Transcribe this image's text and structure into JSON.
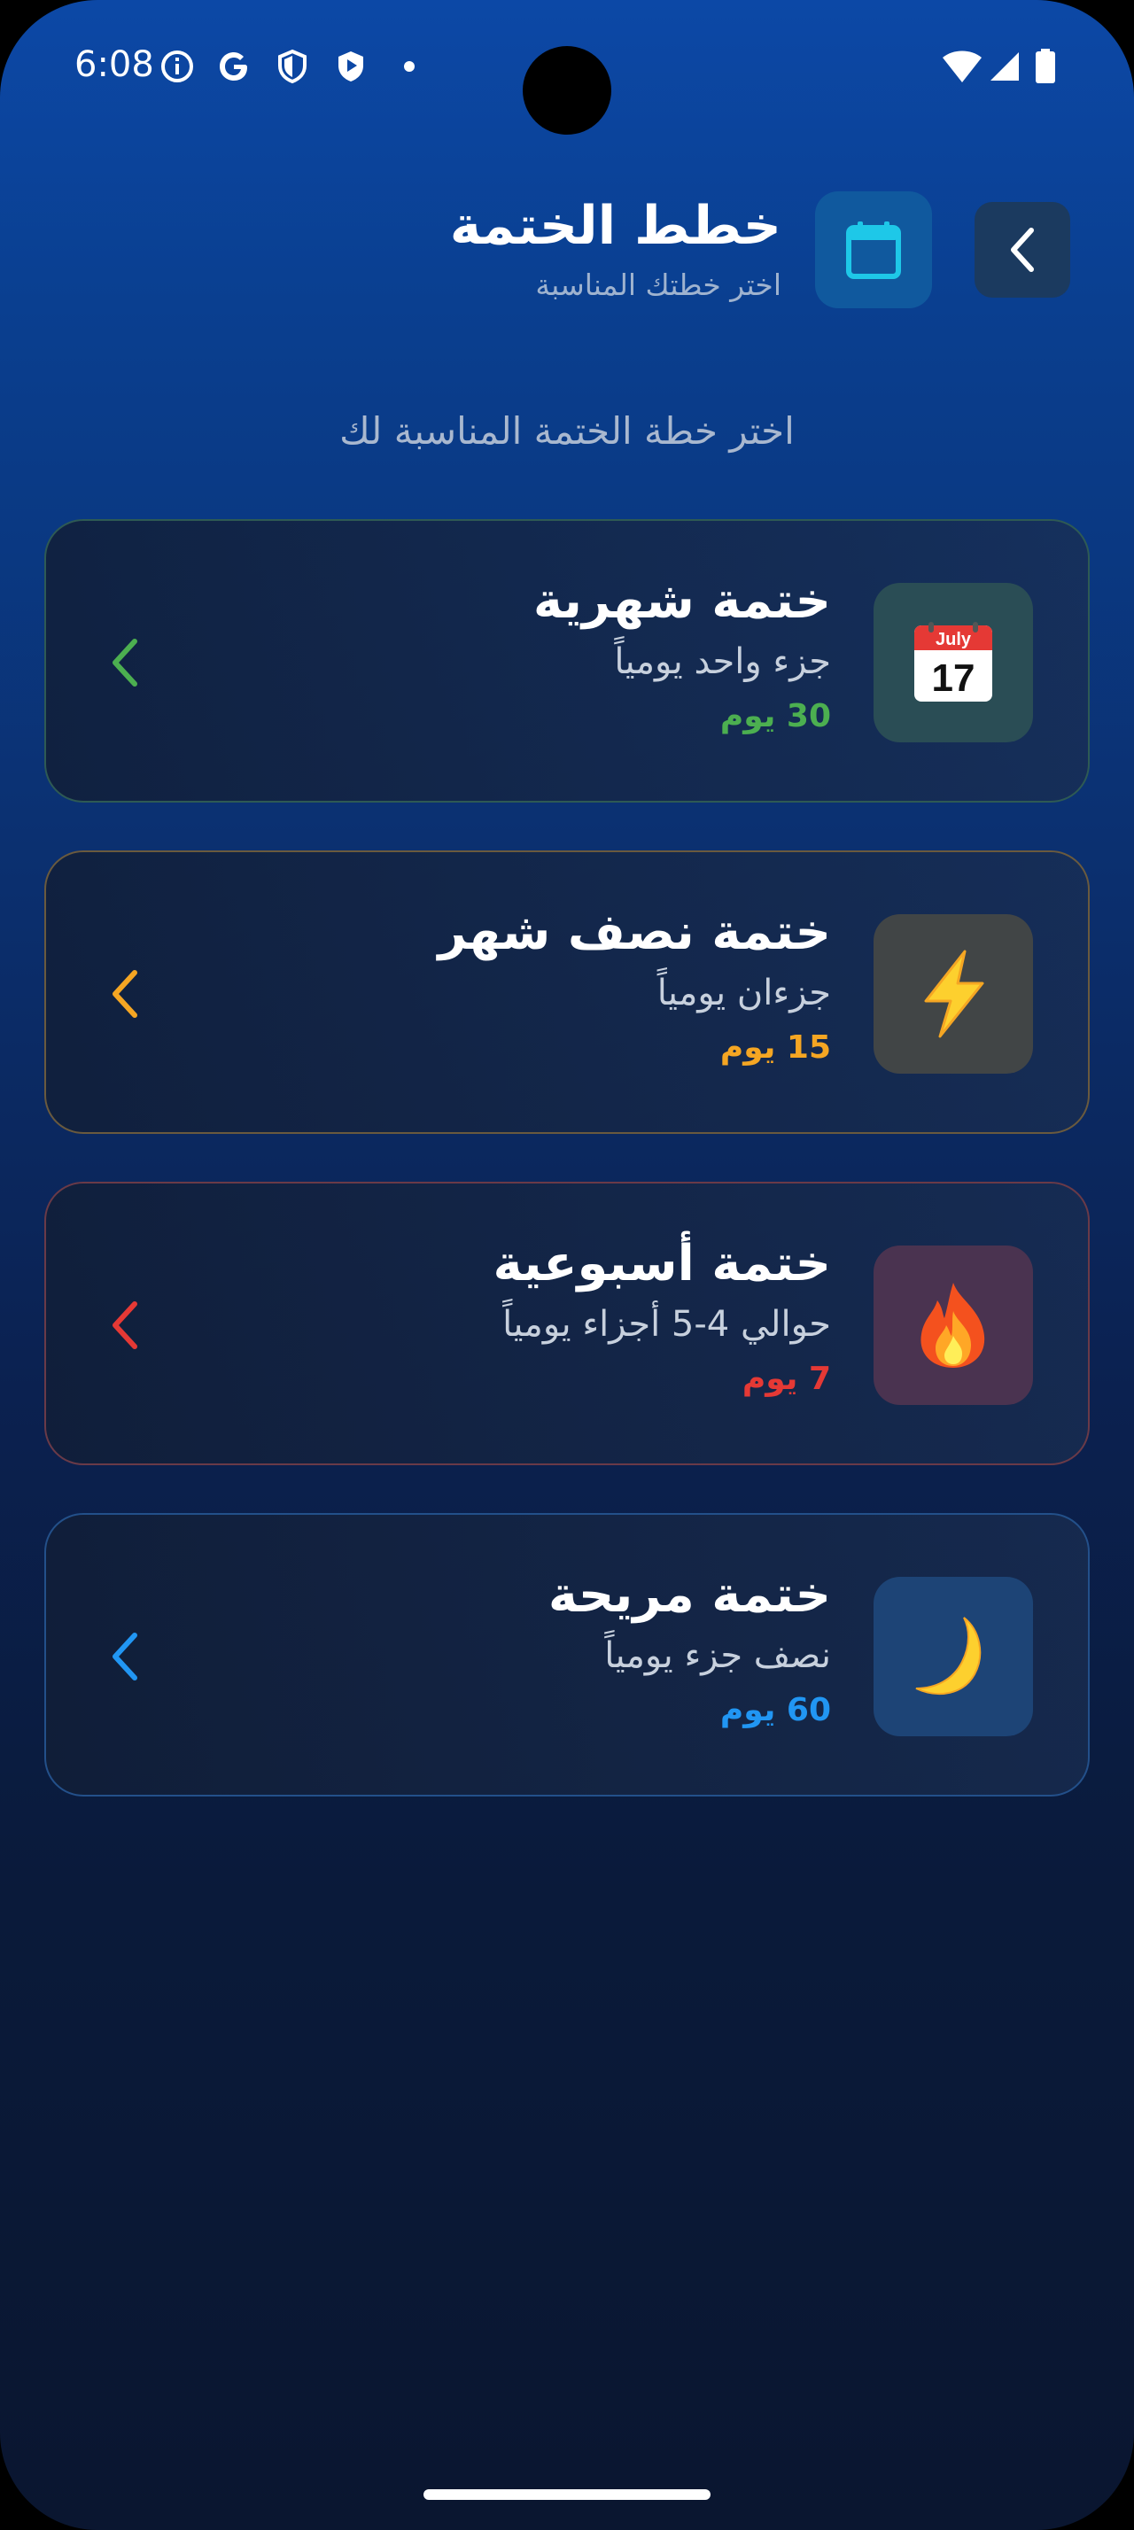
{
  "status_bar": {
    "time": "6:08",
    "icons": [
      "info-icon",
      "google-icon",
      "shield-icon",
      "play-protect-icon",
      "dot-icon",
      "wifi-icon",
      "signal-icon",
      "battery-icon"
    ]
  },
  "header": {
    "title": "خطط الختمة",
    "subtitle": "اختر خطتك المناسبة",
    "back_icon": "chevron-left-icon",
    "header_icon": "calendar-icon"
  },
  "prompt": "اختر خطة الختمة المناسبة لك",
  "plans": [
    {
      "title": "ختمة شهرية",
      "description": "جزء واحد يومياً",
      "days": "30 يوم",
      "icon": "calendar-17-icon",
      "icon_month": "July",
      "icon_day": "17",
      "accent": "#4caf50",
      "border": "#2e5a54",
      "icon_bg": "#2a4d55"
    },
    {
      "title": "ختمة نصف شهر",
      "description": "جزءان يومياً",
      "days": "15 يوم",
      "icon": "lightning-icon",
      "accent": "#f5a623",
      "border": "#6a5a3e",
      "icon_bg": "#414546"
    },
    {
      "title": "ختمة أسبوعية",
      "description": "حوالي 4-5 أجزاء يومياً",
      "days": "7 يوم",
      "icon": "fire-icon",
      "accent": "#e53935",
      "border": "#6a3a48",
      "icon_bg": "#4a3350"
    },
    {
      "title": "ختمة مريحة",
      "description": "نصف جزء يومياً",
      "days": "60 يوم",
      "icon": "crescent-moon-icon",
      "accent": "#2196f3",
      "border": "#23508a",
      "icon_bg": "#1d4476"
    }
  ]
}
